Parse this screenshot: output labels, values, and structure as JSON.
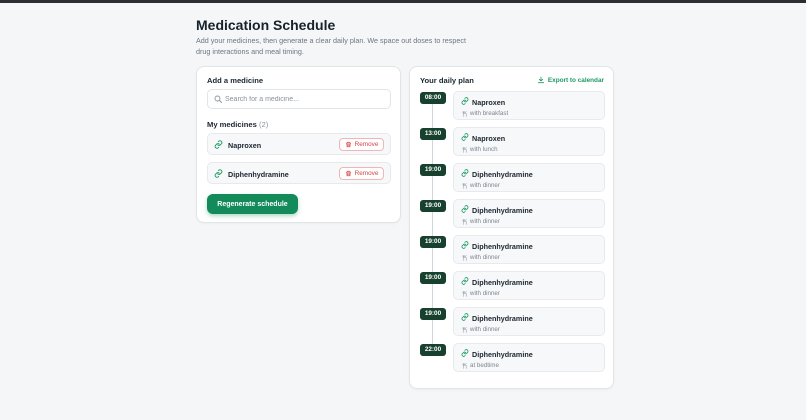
{
  "header": {
    "title": "Medication Schedule",
    "subtitle": "Add your medicines, then generate a clear daily plan. We space out doses to respect drug interactions and meal timing."
  },
  "add_medicine": {
    "title": "Add a medicine",
    "search_placeholder": "Search for a medicine...",
    "my_medicines_label": "My medicines",
    "my_medicines_count": "(2)",
    "medicines": [
      {
        "name": "Naproxen",
        "remove_label": "Remove"
      },
      {
        "name": "Diphenhydramine",
        "remove_label": "Remove"
      }
    ],
    "regenerate_label": "Regenerate schedule"
  },
  "plan": {
    "title": "Your daily plan",
    "export_label": "Export to calendar",
    "slots": [
      {
        "time": "08:00",
        "medicine": "Naproxen",
        "meal": "with breakfast"
      },
      {
        "time": "13:00",
        "medicine": "Naproxen",
        "meal": "with lunch"
      },
      {
        "time": "19:00",
        "medicine": "Diphenhydramine",
        "meal": "with dinner"
      },
      {
        "time": "19:00",
        "medicine": "Diphenhydramine",
        "meal": "with dinner"
      },
      {
        "time": "19:00",
        "medicine": "Diphenhydramine",
        "meal": "with dinner"
      },
      {
        "time": "19:00",
        "medicine": "Diphenhydramine",
        "meal": "with dinner"
      },
      {
        "time": "19:00",
        "medicine": "Diphenhydramine",
        "meal": "with dinner"
      },
      {
        "time": "22:00",
        "medicine": "Diphenhydramine",
        "meal": "at bedtime"
      }
    ]
  },
  "colors": {
    "accent": "#138a5a",
    "time_badge": "#17412e",
    "danger": "#d64545"
  }
}
